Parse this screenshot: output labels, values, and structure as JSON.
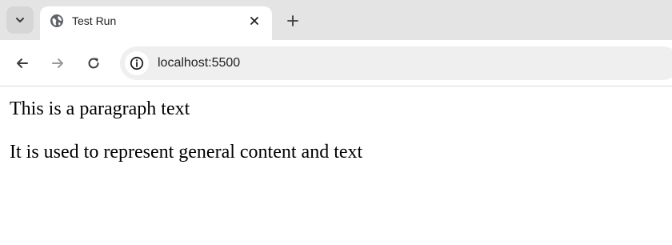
{
  "browser": {
    "tab": {
      "title": "Test Run",
      "favicon": "globe-icon"
    },
    "address_bar": {
      "url": "localhost:5500"
    },
    "icons": {
      "tab_search": "chevron-down-icon",
      "tab_close": "close-icon",
      "new_tab": "plus-icon",
      "back": "arrow-left-icon",
      "forward": "arrow-right-icon",
      "reload": "reload-icon",
      "site_info": "info-icon"
    },
    "colors": {
      "tabstrip": "#e4e4e4",
      "active_tab": "#ffffff",
      "omnibox": "#efefef",
      "icon": "#3c3c3c",
      "icon_disabled": "#9a9a9a"
    }
  },
  "page": {
    "paragraphs": [
      "This is a paragraph text",
      "It is used to represent general content and text"
    ]
  }
}
